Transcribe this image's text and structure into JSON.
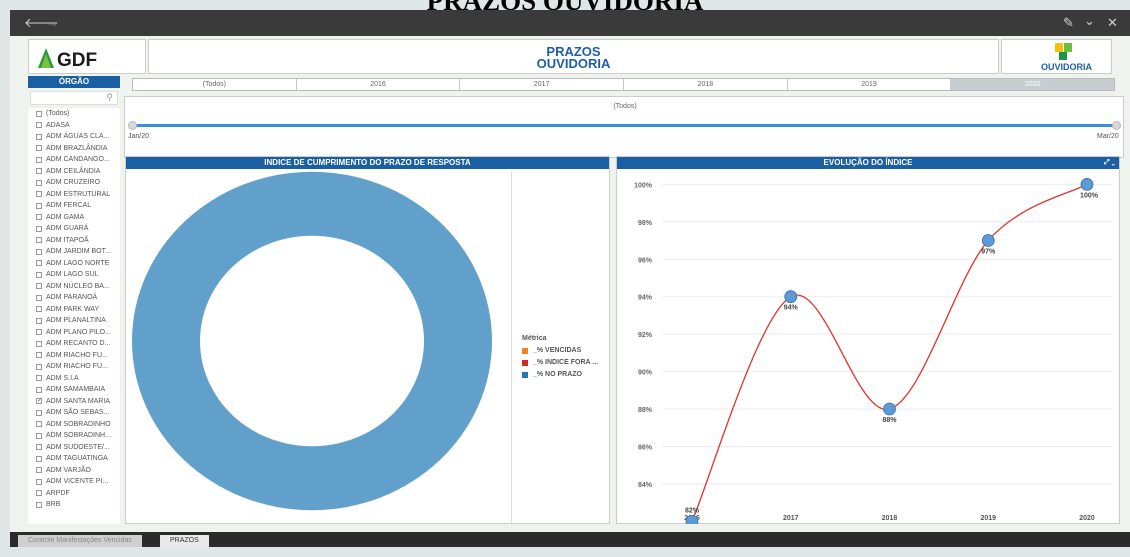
{
  "page_title": "PRAZOS OUVIDORIA",
  "toolbar": {
    "back": "🡐",
    "forward": "→",
    "pen": "✎",
    "chevron": "⌄",
    "close": "✕"
  },
  "header": {
    "line1": "PRAZOS",
    "line2": "OUVIDORIA"
  },
  "logos": {
    "gdf": "GDF",
    "ouv": "OUVIDORIA"
  },
  "orgao": {
    "title": "ÓRGÃO",
    "items": [
      {
        "label": "(Todos)",
        "checked": false
      },
      {
        "label": "ADASA",
        "checked": false
      },
      {
        "label": "ADM ÁGUAS CLA...",
        "checked": false
      },
      {
        "label": "ADM BRAZLÂNDIA",
        "checked": false
      },
      {
        "label": "ADM CANDANGO...",
        "checked": false
      },
      {
        "label": "ADM CEILÂNDIA",
        "checked": false
      },
      {
        "label": "ADM CRUZEIRO",
        "checked": false
      },
      {
        "label": "ADM ESTRUTURAL",
        "checked": false
      },
      {
        "label": "ADM FERCAL",
        "checked": false
      },
      {
        "label": "ADM GAMA",
        "checked": false
      },
      {
        "label": "ADM GUARÁ",
        "checked": false
      },
      {
        "label": "ADM ITAPOÃ",
        "checked": false
      },
      {
        "label": "ADM JARDIM BOT...",
        "checked": false
      },
      {
        "label": "ADM LAGO NORTE",
        "checked": false
      },
      {
        "label": "ADM LAGO SUL",
        "checked": false
      },
      {
        "label": "ADM NÚCLEO BA...",
        "checked": false
      },
      {
        "label": "ADM PARANOÁ",
        "checked": false
      },
      {
        "label": "ADM PARK WAY",
        "checked": false
      },
      {
        "label": "ADM PLANALTINA",
        "checked": false
      },
      {
        "label": "ADM PLANO PILO...",
        "checked": false
      },
      {
        "label": "ADM RECANTO D...",
        "checked": false
      },
      {
        "label": "ADM RIACHO FU...",
        "checked": false
      },
      {
        "label": "ADM RIACHO FU...",
        "checked": false
      },
      {
        "label": "ADM S.I.A",
        "checked": false
      },
      {
        "label": "ADM SAMAMBAIA",
        "checked": false
      },
      {
        "label": "ADM SANTA MARIA",
        "checked": true
      },
      {
        "label": "ADM SÃO SEBAS...",
        "checked": false
      },
      {
        "label": "ADM SOBRADINHO",
        "checked": false
      },
      {
        "label": "ADM SOBRADINH...",
        "checked": false
      },
      {
        "label": "ADM SUDOESTE/...",
        "checked": false
      },
      {
        "label": "ADM TAGUATINGA",
        "checked": false
      },
      {
        "label": "ADM VARJÃO",
        "checked": false
      },
      {
        "label": "ADM VICENTE PI...",
        "checked": false
      },
      {
        "label": "ARPDF",
        "checked": false
      },
      {
        "label": "BRB",
        "checked": false
      }
    ]
  },
  "years": {
    "items": [
      "(Todos)",
      "2016",
      "2017",
      "2018",
      "2019",
      "2020"
    ],
    "selected": "2020"
  },
  "slider": {
    "label": "(Todos)",
    "start": "Jan/20",
    "end": "Mar/20"
  },
  "donut_panel": {
    "title": "INDICE DE CUMPRIMENTO DO PRAZO DE RESPOSTA",
    "legend_title": "Métrica",
    "legend": [
      {
        "label": "_% VENCIDAS",
        "color": "#f0831e"
      },
      {
        "label": "_% INDICE FORA ...",
        "color": "#d62728"
      },
      {
        "label": "_% NO PRAZO",
        "color": "#1f77b4"
      }
    ]
  },
  "line_panel": {
    "title": "EVOLUÇÃO DO ÍNDICE"
  },
  "chart_data": [
    {
      "type": "pie",
      "title": "INDICE DE CUMPRIMENTO DO PRAZO DE RESPOSTA",
      "legend_title": "Métrica",
      "categories": [
        "_% VENCIDAS",
        "_% INDICE FORA ...",
        "_% NO PRAZO"
      ],
      "values": [
        0,
        0,
        100
      ],
      "colors": [
        "#f0831e",
        "#d62728",
        "#62a0cc"
      ],
      "legend_position": "right"
    },
    {
      "type": "line",
      "title": "EVOLUÇÃO DO ÍNDICE",
      "x": [
        "2016",
        "2017",
        "2018",
        "2019",
        "2020"
      ],
      "values": [
        82,
        94,
        88,
        97,
        100
      ],
      "data_labels": [
        "82%",
        "94%",
        "88%",
        "97%",
        "100%"
      ],
      "yticks": [
        "84%",
        "86%",
        "88%",
        "90%",
        "92%",
        "94%",
        "96%",
        "98%",
        "100%"
      ],
      "ylim": [
        82.5,
        100.5
      ],
      "grid": true,
      "line_color": "#e0312a",
      "marker_color": "#5b9bd5"
    }
  ],
  "tabs": [
    {
      "label": "Controle Manifestações Vencidas",
      "active": false
    },
    {
      "label": "PRAZOS",
      "active": true
    }
  ]
}
